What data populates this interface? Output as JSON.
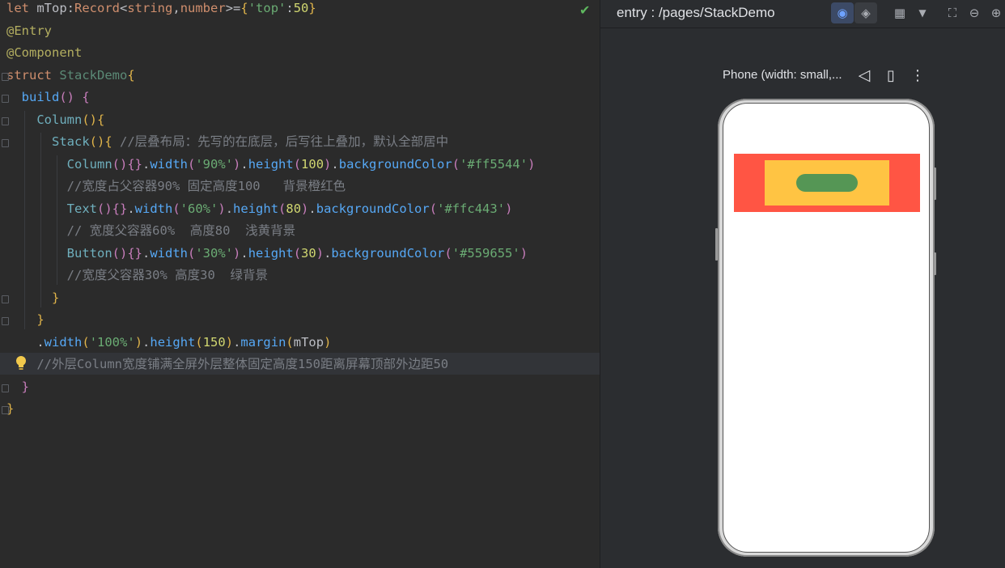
{
  "editor": {
    "lines": [
      [
        {
          "c": "kw",
          "t": "let "
        },
        {
          "c": "plain",
          "t": "mTop"
        },
        {
          "c": "plain",
          "t": ":"
        },
        {
          "c": "kw",
          "t": "Record"
        },
        {
          "c": "plain",
          "t": "<"
        },
        {
          "c": "kw",
          "t": "string"
        },
        {
          "c": "plain",
          "t": ","
        },
        {
          "c": "kw",
          "t": "number"
        },
        {
          "c": "plain",
          "t": ">="
        },
        {
          "c": "brace-y",
          "t": "{"
        },
        {
          "c": "str",
          "t": "'top'"
        },
        {
          "c": "plain",
          "t": ":"
        },
        {
          "c": "num2",
          "t": "50"
        },
        {
          "c": "brace-y",
          "t": "}"
        }
      ],
      [
        {
          "c": "ann",
          "t": "@Entry"
        }
      ],
      [
        {
          "c": "ann",
          "t": "@Component"
        }
      ],
      [
        {
          "c": "kw",
          "t": "struct "
        },
        {
          "c": "cls",
          "t": "StackDemo"
        },
        {
          "c": "brace-y",
          "t": "{"
        }
      ],
      [
        {
          "c": "plain",
          "t": "  "
        },
        {
          "c": "fn",
          "t": "build"
        },
        {
          "c": "brace-p",
          "t": "() "
        },
        {
          "c": "brace-p",
          "t": "{"
        }
      ],
      [
        {
          "c": "plain",
          "t": "    "
        },
        {
          "c": "type",
          "t": "Column"
        },
        {
          "c": "brace-y",
          "t": "(){"
        }
      ],
      [
        {
          "c": "plain",
          "t": "      "
        },
        {
          "c": "type",
          "t": "Stack"
        },
        {
          "c": "brace-y",
          "t": "(){ "
        },
        {
          "c": "cmt",
          "t": "//层叠布局：先写的在底层，后写往上叠加，默认全部居中"
        }
      ],
      [
        {
          "c": "plain",
          "t": "        "
        },
        {
          "c": "type",
          "t": "Column"
        },
        {
          "c": "brace-p",
          "t": "(){}"
        },
        {
          "c": "plain",
          "t": "."
        },
        {
          "c": "fn",
          "t": "width"
        },
        {
          "c": "brace-p",
          "t": "("
        },
        {
          "c": "str",
          "t": "'90%'"
        },
        {
          "c": "brace-p",
          "t": ")"
        },
        {
          "c": "plain",
          "t": "."
        },
        {
          "c": "fn",
          "t": "height"
        },
        {
          "c": "brace-p",
          "t": "("
        },
        {
          "c": "num2",
          "t": "100"
        },
        {
          "c": "brace-p",
          "t": ")"
        },
        {
          "c": "plain",
          "t": "."
        },
        {
          "c": "fn",
          "t": "backgroundColor"
        },
        {
          "c": "brace-p",
          "t": "("
        },
        {
          "c": "str",
          "t": "'#ff5544'"
        },
        {
          "c": "brace-p",
          "t": ")"
        }
      ],
      [
        {
          "c": "plain",
          "t": "        "
        },
        {
          "c": "cmt",
          "t": "//宽度占父容器90% 固定高度100   背景橙红色"
        }
      ],
      [
        {
          "c": "plain",
          "t": "        "
        },
        {
          "c": "type",
          "t": "Text"
        },
        {
          "c": "brace-p",
          "t": "(){}"
        },
        {
          "c": "plain",
          "t": "."
        },
        {
          "c": "fn",
          "t": "width"
        },
        {
          "c": "brace-p",
          "t": "("
        },
        {
          "c": "str",
          "t": "'60%'"
        },
        {
          "c": "brace-p",
          "t": ")"
        },
        {
          "c": "plain",
          "t": "."
        },
        {
          "c": "fn",
          "t": "height"
        },
        {
          "c": "brace-p",
          "t": "("
        },
        {
          "c": "num2",
          "t": "80"
        },
        {
          "c": "brace-p",
          "t": ")"
        },
        {
          "c": "plain",
          "t": "."
        },
        {
          "c": "fn",
          "t": "backgroundColor"
        },
        {
          "c": "brace-p",
          "t": "("
        },
        {
          "c": "str",
          "t": "'#ffc443'"
        },
        {
          "c": "brace-p",
          "t": ")"
        }
      ],
      [
        {
          "c": "plain",
          "t": "        "
        },
        {
          "c": "cmt",
          "t": "// 宽度父容器60%  高度80  浅黄背景"
        }
      ],
      [
        {
          "c": "plain",
          "t": "        "
        },
        {
          "c": "type",
          "t": "Button"
        },
        {
          "c": "brace-p",
          "t": "(){}"
        },
        {
          "c": "plain",
          "t": "."
        },
        {
          "c": "fn",
          "t": "width"
        },
        {
          "c": "brace-p",
          "t": "("
        },
        {
          "c": "str",
          "t": "'30%'"
        },
        {
          "c": "brace-p",
          "t": ")"
        },
        {
          "c": "plain",
          "t": "."
        },
        {
          "c": "fn",
          "t": "height"
        },
        {
          "c": "brace-p",
          "t": "("
        },
        {
          "c": "num2",
          "t": "30"
        },
        {
          "c": "brace-p",
          "t": ")"
        },
        {
          "c": "plain",
          "t": "."
        },
        {
          "c": "fn",
          "t": "backgroundColor"
        },
        {
          "c": "brace-p",
          "t": "("
        },
        {
          "c": "str",
          "t": "'#559655'"
        },
        {
          "c": "brace-p",
          "t": ")"
        }
      ],
      [
        {
          "c": "plain",
          "t": "        "
        },
        {
          "c": "cmt",
          "t": "//宽度父容器30% 高度30  绿背景"
        }
      ],
      [
        {
          "c": "plain",
          "t": "      "
        },
        {
          "c": "brace-y",
          "t": "}"
        }
      ],
      [
        {
          "c": "plain",
          "t": "    "
        },
        {
          "c": "brace-y",
          "t": "}"
        }
      ],
      [
        {
          "c": "plain",
          "t": "    ."
        },
        {
          "c": "fn",
          "t": "width"
        },
        {
          "c": "brace-y",
          "t": "("
        },
        {
          "c": "str",
          "t": "'100%'"
        },
        {
          "c": "brace-y",
          "t": ")"
        },
        {
          "c": "plain",
          "t": "."
        },
        {
          "c": "fn",
          "t": "height"
        },
        {
          "c": "brace-y",
          "t": "("
        },
        {
          "c": "num2",
          "t": "150"
        },
        {
          "c": "brace-y",
          "t": ")"
        },
        {
          "c": "plain",
          "t": "."
        },
        {
          "c": "fn",
          "t": "margin"
        },
        {
          "c": "brace-y",
          "t": "("
        },
        {
          "c": "plain",
          "t": "mTop"
        },
        {
          "c": "brace-y",
          "t": ")"
        }
      ],
      [
        {
          "c": "plain",
          "t": "    "
        },
        {
          "c": "cmt",
          "t": "//外层Column宽度铺满全屏外层整体固定高度150距离屏幕顶部外边距50"
        }
      ],
      [
        {
          "c": "plain",
          "t": "  "
        },
        {
          "c": "brace-p",
          "t": "}"
        }
      ],
      [
        {
          "c": "brace-y",
          "t": "}"
        }
      ]
    ],
    "status_icon": "check-icon",
    "status_glyph": "✔",
    "hint_icon": "lightbulb-icon"
  },
  "preview": {
    "route_title": "entry : /pages/StackDemo",
    "device_label": "Phone (width: small,...",
    "toolbar": [
      {
        "name": "inspect-icon",
        "glyph": "◉"
      },
      {
        "name": "layers-icon",
        "glyph": "◈"
      },
      {
        "name": "components-icon",
        "glyph": "▦"
      },
      {
        "name": "dropdown-icon",
        "glyph": "▼"
      },
      {
        "name": "crop-icon",
        "glyph": "⛶"
      },
      {
        "name": "zoom-out-icon",
        "glyph": "⊖"
      },
      {
        "name": "zoom-in-icon",
        "glyph": "⊕"
      }
    ],
    "device_actions": [
      {
        "name": "back-icon",
        "glyph": "◁"
      },
      {
        "name": "rotate-device-icon",
        "glyph": "▯"
      },
      {
        "name": "more-icon",
        "glyph": "⋮"
      }
    ],
    "colors": {
      "outer": "#ff5544",
      "middle": "#ffc443",
      "button": "#559655"
    }
  }
}
